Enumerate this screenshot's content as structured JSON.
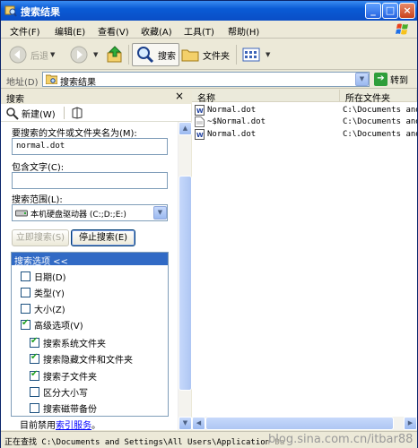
{
  "window": {
    "title": "搜索结果"
  },
  "menu": [
    "文件(F)",
    "编辑(E)",
    "查看(V)",
    "收藏(A)",
    "工具(T)",
    "帮助(H)"
  ],
  "toolbar": {
    "back": "后退",
    "search": "搜索",
    "folders": "文件夹"
  },
  "address": {
    "label": "地址(D)",
    "value": "搜索结果",
    "go": "转到"
  },
  "left_pane": {
    "header": "搜索",
    "new_button": "新建(W)",
    "filename_label": "要搜索的文件或文件夹名为(M):",
    "filename_value": "normal.dot",
    "contains_label": "包含文字(C):",
    "contains_value": "",
    "lookin_label": "搜索范围(L):",
    "lookin_value": "本机硬盘驱动器 (C:;D:;E:)",
    "search_now": "立即搜索(S)",
    "stop_search": "停止搜索(E)",
    "options_header": "搜索选项 <<",
    "options": [
      {
        "label": "日期(D)",
        "checked": false
      },
      {
        "label": "类型(Y)",
        "checked": false
      },
      {
        "label": "大小(Z)",
        "checked": false
      },
      {
        "label": "高级选项(V)",
        "checked": true
      }
    ],
    "advanced": [
      {
        "label": "搜索系统文件夹",
        "checked": true
      },
      {
        "label": "搜索隐藏文件和文件夹",
        "checked": true
      },
      {
        "label": "搜索子文件夹",
        "checked": true
      },
      {
        "label": "区分大小写",
        "checked": false
      },
      {
        "label": "搜索磁带备份",
        "checked": false
      }
    ],
    "index_note_prefix": "目前禁用",
    "index_note_link": "索引服务",
    "index_note_suffix": "。"
  },
  "results": {
    "columns": [
      "名称",
      "所在文件夹"
    ],
    "rows": [
      {
        "name": "Normal.dot",
        "folder": "C:\\Documents and"
      },
      {
        "name": "~$Normal.dot",
        "folder": "C:\\Documents and"
      },
      {
        "name": "Normal.dot",
        "folder": "C:\\Documents and"
      }
    ]
  },
  "status": {
    "text": "正在查找 C:\\Documents and Settings\\All Users\\Application Da",
    "watermark": "blog.sina.com.cn/itbar88"
  }
}
